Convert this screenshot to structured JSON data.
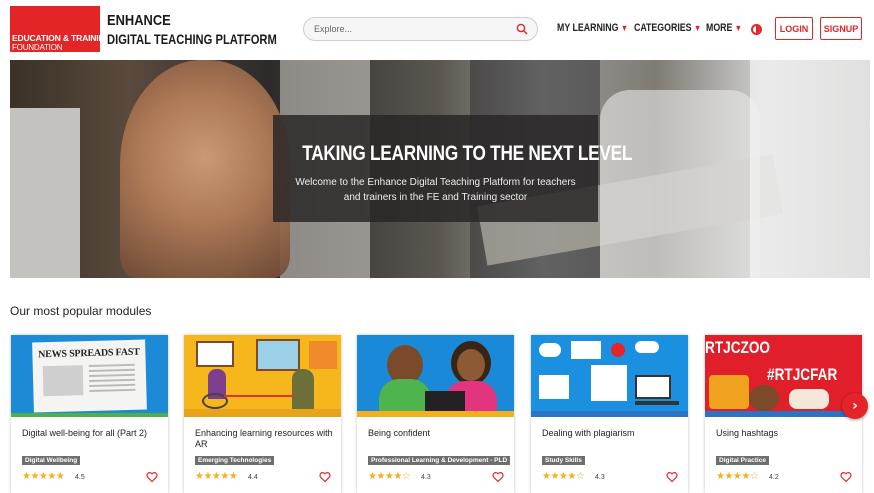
{
  "header": {
    "logo": {
      "line1": "EDUCATION & TRAINING",
      "line2": "FOUNDATION"
    },
    "brand": {
      "line1": "ENHANCE",
      "line2": "DIGITAL TEACHING PLATFORM"
    },
    "search": {
      "placeholder": "Explore..."
    },
    "nav": [
      {
        "label": "MY LEARNING"
      },
      {
        "label": "CATEGORIES"
      },
      {
        "label": "MORE"
      }
    ],
    "login_label": "LOGIN",
    "signup_label": "SIGNUP"
  },
  "hero": {
    "title": "TAKING LEARNING TO THE NEXT LEVEL",
    "subtitle_line1": "Welcome to the Enhance Digital Teaching Platform for teachers",
    "subtitle_line2": "and trainers in the FE and Training sector"
  },
  "modules": {
    "section_title": "Our most popular modules",
    "items": [
      {
        "title": "Digital well-being for all (Part 2)",
        "tag": "Digital Wellbeing",
        "rating": "4.5",
        "stars": "★★★★★",
        "image_text": "NEWS SPREADS FAST"
      },
      {
        "title": "Enhancing learning resources with AR",
        "tag": "Emerging Technologies",
        "rating": "4.4",
        "stars": "★★★★★"
      },
      {
        "title": "Being confident",
        "tag": "Professional Learning & Development - PLD",
        "rating": "4.3",
        "stars": "★★★★☆"
      },
      {
        "title": "Dealing with plagiarism",
        "tag": "Study Skills",
        "rating": "4.3",
        "stars": "★★★★☆"
      },
      {
        "title": "Using hashtags",
        "tag": "Digital Practice",
        "rating": "4.2",
        "stars": "★★★★☆",
        "image_text_1": "RTJCZOO",
        "image_text_2": "#RTJCFAR"
      }
    ]
  },
  "colors": {
    "accent": "#e42527",
    "star": "#f2b01e",
    "tag_bg": "#6e6e6e"
  },
  "icons": {
    "search": "search-icon",
    "caret": "chevron-down-icon",
    "contrast": "contrast-icon",
    "heart": "heart-icon",
    "next": "chevron-right-icon"
  }
}
